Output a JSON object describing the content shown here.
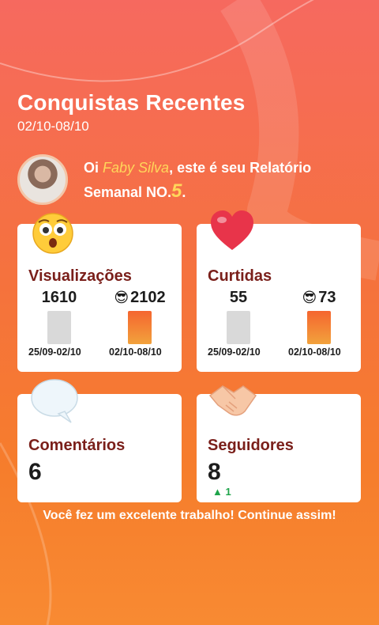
{
  "header": {
    "title": "Conquistas Recentes",
    "period": "02/10-08/10"
  },
  "greeting": {
    "prefix": "Oi ",
    "name": "Faby Silva",
    "suffix": ", este é seu Relatório Semanal NO.",
    "number": "5",
    "end": "."
  },
  "cards": {
    "views": {
      "label": "Visualizações",
      "prev_value": "1610",
      "curr_value": "2102",
      "prev_range": "25/09-02/10",
      "curr_range": "02/10-08/10",
      "icon": "surprised-face-emoji"
    },
    "likes": {
      "label": "Curtidas",
      "prev_value": "55",
      "curr_value": "73",
      "prev_range": "25/09-02/10",
      "curr_range": "02/10-08/10",
      "icon": "heart-emoji"
    },
    "comments": {
      "label": "Comentários",
      "value": "6",
      "icon": "speech-bubble-emoji"
    },
    "followers": {
      "label": "Seguidores",
      "value": "8",
      "delta": "1",
      "icon": "handshake-emoji"
    }
  },
  "footer": {
    "message": "Você fez um excelente trabalho! Continue assim!"
  },
  "colors": {
    "accent": "#ffd65a",
    "label": "#7a1f1a",
    "bar_current": "#f5652f",
    "bar_previous": "#d9d9d9",
    "up": "#1ea44a"
  }
}
